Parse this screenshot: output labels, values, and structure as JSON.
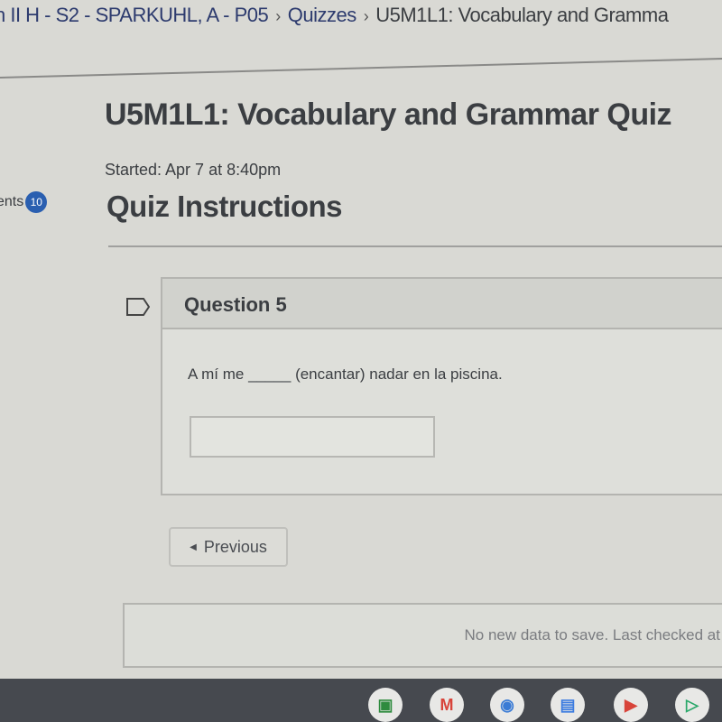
{
  "breadcrumb": {
    "items": [
      "n II H - S2 - SPARKUHL, A - P05",
      "Quizzes",
      "U5M1L1: Vocabulary and Gramma"
    ]
  },
  "quiz": {
    "title": "U5M1L1: Vocabulary and Grammar Quiz",
    "started": "Started: Apr 7 at 8:40pm",
    "instructions_heading": "Quiz Instructions"
  },
  "sidebar": {
    "label": "ents",
    "badge": "10"
  },
  "question": {
    "heading": "Question 5",
    "text": "A mí me _____ (encantar) nadar en la piscina.",
    "answer_value": ""
  },
  "nav": {
    "previous_label": "Previous"
  },
  "status": {
    "save_text": "No new data to save. Last checked at"
  },
  "shelf": {
    "apps": [
      {
        "icon": "google-classroom-icon",
        "color": "#2e8b3e"
      },
      {
        "icon": "gmail-icon",
        "color": "#d8443a"
      },
      {
        "icon": "chrome-icon",
        "color": "#3a7bd5"
      },
      {
        "icon": "google-docs-icon",
        "color": "#3b7be0"
      },
      {
        "icon": "youtube-icon",
        "color": "#d8443a"
      },
      {
        "icon": "play-store-icon",
        "color": "#2aa86a"
      }
    ]
  },
  "colors": {
    "link": "#2d3b6e",
    "badge": "#2a5fb0"
  }
}
